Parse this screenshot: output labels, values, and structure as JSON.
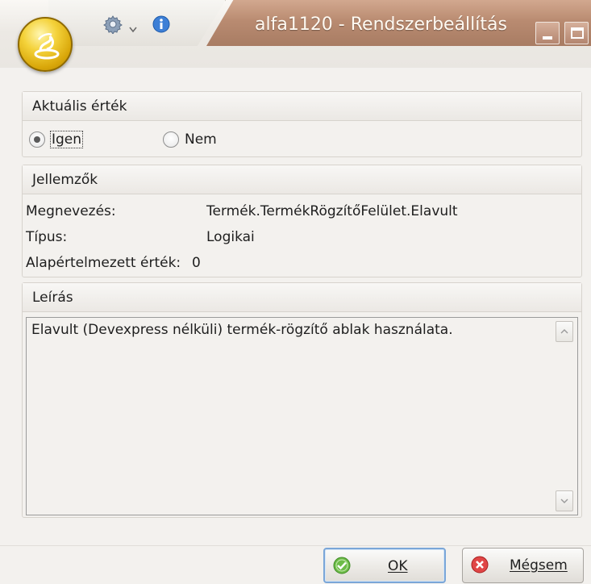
{
  "window": {
    "title": "alfa1120 - Rendszerbeállítás",
    "icons": [
      "app-orb-icon",
      "gear-icon",
      "chevron-down-icon",
      "info-icon",
      "minimize-icon",
      "maximize-icon"
    ]
  },
  "current_value": {
    "header": "Aktuális érték",
    "options": [
      {
        "label": "Igen",
        "checked": true
      },
      {
        "label": "Nem",
        "checked": false
      }
    ]
  },
  "properties": {
    "header": "Jellemzők",
    "rows": [
      {
        "label": "Megnevezés:",
        "value": "Termék.TermékRögzítőFelület.Elavult"
      },
      {
        "label": "Típus:",
        "value": "Logikai"
      },
      {
        "label": "Alapértelmezett érték:",
        "value": "0"
      }
    ]
  },
  "description": {
    "header": "Leírás",
    "text": "Elavult (Devexpress nélküli) termék-rögzítő ablak használata."
  },
  "buttons": {
    "ok_label": "OK",
    "cancel_label": "Mégsem"
  },
  "colors": {
    "title_accent": "#b98b71",
    "ok_icon": "#5cae3c",
    "cancel_icon": "#d9383a",
    "default_button_border": "#7aa6d8"
  }
}
